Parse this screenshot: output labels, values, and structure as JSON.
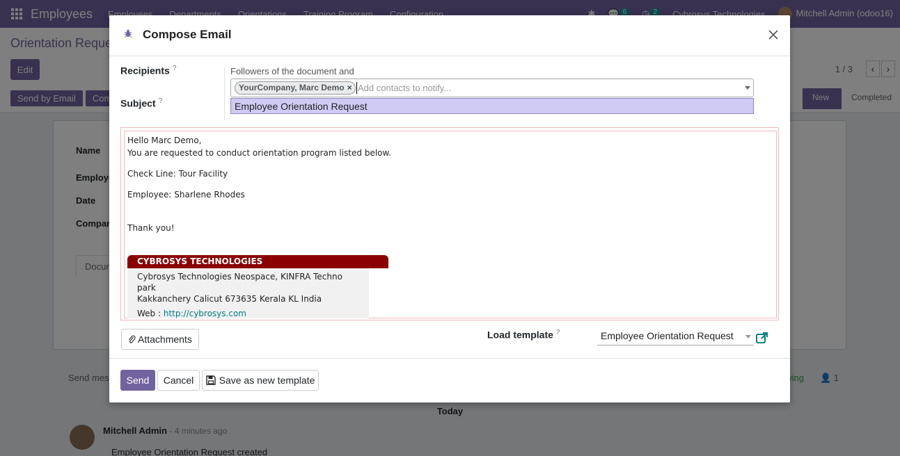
{
  "topbar": {
    "app_name": "Employees",
    "menu": [
      "Employees",
      "Departments",
      "Orientations",
      "Training Program",
      "Configuration"
    ],
    "messages_count": "6",
    "activities_count": "2",
    "company": "Cybrosys Technologies",
    "user": "Mitchell Admin (odoo16)"
  },
  "control_panel": {
    "breadcrumb": "Orientation Request",
    "edit_label": "Edit",
    "pager": "1 / 3",
    "header_buttons": [
      "Send by Email",
      "Com"
    ],
    "status_new": "New",
    "status_completed": "Completed"
  },
  "form": {
    "labels": [
      "Name",
      "Employe",
      "Date",
      "Compar"
    ],
    "tab": "Docum"
  },
  "chatter": {
    "send_message": "Send mes",
    "following": "wing",
    "followers_count": "1",
    "today": "Today",
    "author": "Mitchell Admin",
    "ago": "- 4 minutes ago",
    "body": "Employee Orientation Request created"
  },
  "modal": {
    "title": "Compose Email",
    "recipients_label": "Recipients",
    "subject_label": "Subject",
    "help_mark": "?",
    "followers_text": "Followers of the document and",
    "recipient_chip": "YourCompany, Marc Demo",
    "recipients_placeholder": "Add contacts to notify...",
    "subject_value": "Employee Orientation Request",
    "body": {
      "greeting": "Hello Marc Demo,",
      "line1": "You are requested to conduct orientation program listed below.",
      "check_line": "Check Line: Tour Facility",
      "employee": "Employee: Sharlene Rhodes",
      "thanks": "Thank you!"
    },
    "signature": {
      "company": "CYBROSYS TECHNOLOGIES",
      "address1": "Cybrosys Technologies Neospace, KINFRA Techno park",
      "address2": "Kakkanchery Calicut 673635 Kerala KL India",
      "web_label": "Web : ",
      "web_url": "http://cybrosys.com"
    },
    "attachments_label": "Attachments",
    "load_template_label": "Load template",
    "template_value": "Employee Orientation Request",
    "send_label": "Send",
    "cancel_label": "Cancel",
    "save_template_label": "Save as new template"
  },
  "colors": {
    "brand": "#71639e",
    "signature_header": "#8b0000",
    "link": "#017e84",
    "subject_highlight": "#d0cbf5"
  }
}
